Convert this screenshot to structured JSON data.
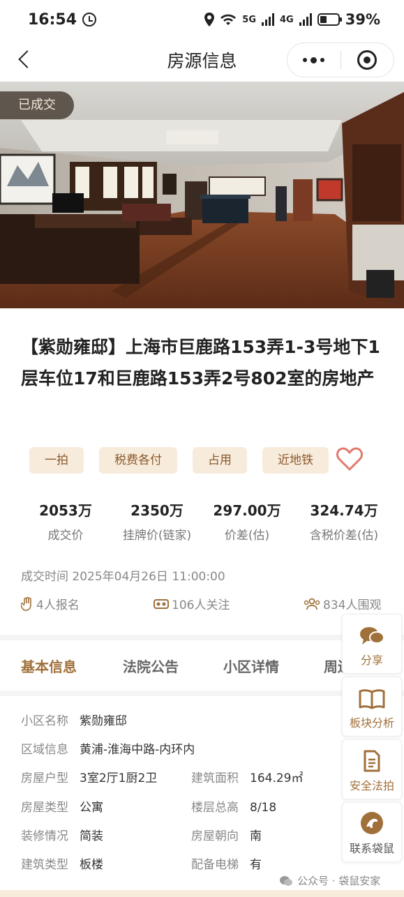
{
  "status_bar": {
    "time": "16:54",
    "network_5g": "5G",
    "network_4g": "4G",
    "battery": "39%",
    "battery_level": 0.39
  },
  "nav": {
    "title": "房源信息"
  },
  "listing": {
    "badge": "已成交",
    "title": "【紫勋雍邸】上海市巨鹿路153弄1-3号地下1层车位17和巨鹿路153弄2号802室的房地产",
    "tags": [
      "一拍",
      "税费各付",
      "占用",
      "近地铁"
    ],
    "stats": [
      {
        "value": "2053万",
        "label": "成交价"
      },
      {
        "value": "2350万",
        "label": "挂牌价(链家)"
      },
      {
        "value": "297.00万",
        "label": "价差(估)"
      },
      {
        "value": "324.74万",
        "label": "含税价差(估)"
      }
    ],
    "deal_time": "成交时间 2025年04月26日 11:00:00",
    "metrics": {
      "signups": "4人报名",
      "follows": "106人关注",
      "watchers": "834人围观"
    }
  },
  "tabs": [
    "基本信息",
    "法院公告",
    "小区详情",
    "周边"
  ],
  "basic_info": {
    "community_label": "小区名称",
    "community": "紫勋雍邸",
    "region_label": "区域信息",
    "region": "黄浦-淮海中路-内环内",
    "layout_label": "房屋户型",
    "layout": "3室2厅1厨2卫",
    "area_label": "建筑面积",
    "area": "164.29㎡",
    "type_label": "房屋类型",
    "type": "公寓",
    "floor_label": "楼层总高",
    "floor": "8/18",
    "decor_label": "装修情况",
    "decor": "简装",
    "orient_label": "房屋朝向",
    "orient": "南",
    "build_label": "建筑类型",
    "build": "板楼",
    "elevator_label": "配备电梯",
    "elevator": "有"
  },
  "float_actions": [
    "分享",
    "板块分析",
    "安全法拍",
    "联系袋鼠"
  ],
  "watermark": "公众号 · 袋鼠安家",
  "colors": {
    "accent": "#a0703a",
    "tag_bg": "#f7ebdc",
    "heart": "#e07a6c"
  }
}
